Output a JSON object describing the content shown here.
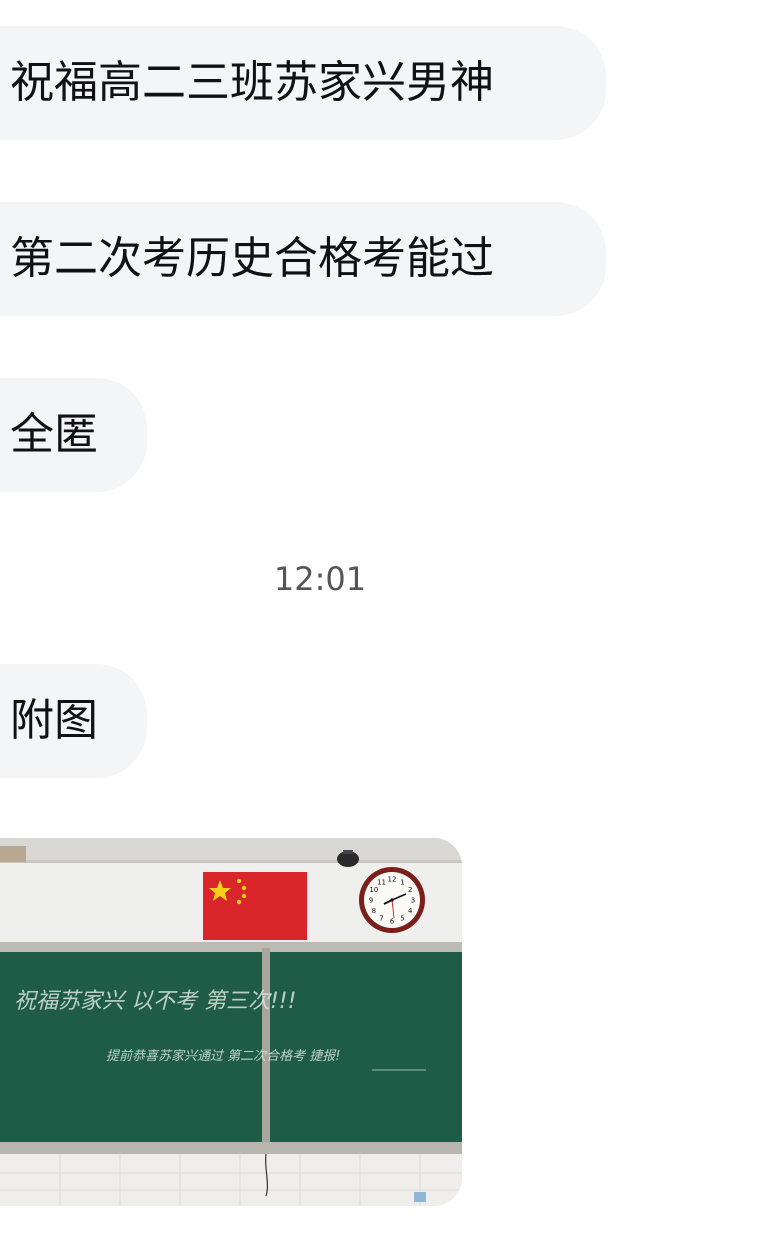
{
  "messages": [
    {
      "text": "祝福高二三班苏家兴男神"
    },
    {
      "text": "第二次考历史合格考能过"
    },
    {
      "text": "全匿"
    },
    {
      "text": "附图"
    }
  ],
  "timestamp": "12:01",
  "photo": {
    "chalk_line_1": "祝福苏家兴 以不考 第三次!!!",
    "chalk_line_2": "提前恭喜苏家兴通过 第二次合格考 捷报!",
    "clock_numbers": [
      "12",
      "1",
      "2",
      "3",
      "4",
      "5",
      "6",
      "7",
      "8",
      "9",
      "10",
      "11"
    ],
    "colors": {
      "board": "#1f5c48",
      "flag": "#d8262a",
      "wall": "#efefee"
    }
  }
}
